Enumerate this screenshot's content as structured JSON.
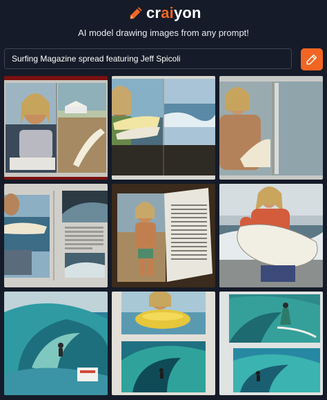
{
  "header": {
    "logo_icon": "pencil-icon",
    "logo_text_pre": "cr",
    "logo_text_accent": "ai",
    "logo_text_post": "yon",
    "tagline": "AI model drawing images from any prompt!"
  },
  "prompt": {
    "value": "Surfing Magazine spread featuring Jeff Spicoli",
    "button_icon": "pencil-icon"
  },
  "colors": {
    "background": "#151b28",
    "accent": "#f26522",
    "input_border": "#3d4556"
  },
  "results": {
    "count": 9,
    "tiles": [
      {
        "name": "image-1",
        "subject": "magazine spread portrait with surfboard"
      },
      {
        "name": "image-2",
        "subject": "surfer holding board beside ocean spread"
      },
      {
        "name": "image-3",
        "subject": "shirtless surfer portrait spread"
      },
      {
        "name": "image-4",
        "subject": "magazine page with wave photos"
      },
      {
        "name": "image-5",
        "subject": "surfer on beach magazine page"
      },
      {
        "name": "image-6",
        "subject": "surfer in red shirt holding surfboard"
      },
      {
        "name": "image-7",
        "subject": "surfer inside barrel wave"
      },
      {
        "name": "image-8",
        "subject": "surfer on yellow board and wave"
      },
      {
        "name": "image-9",
        "subject": "surfers riding green waves"
      }
    ]
  }
}
